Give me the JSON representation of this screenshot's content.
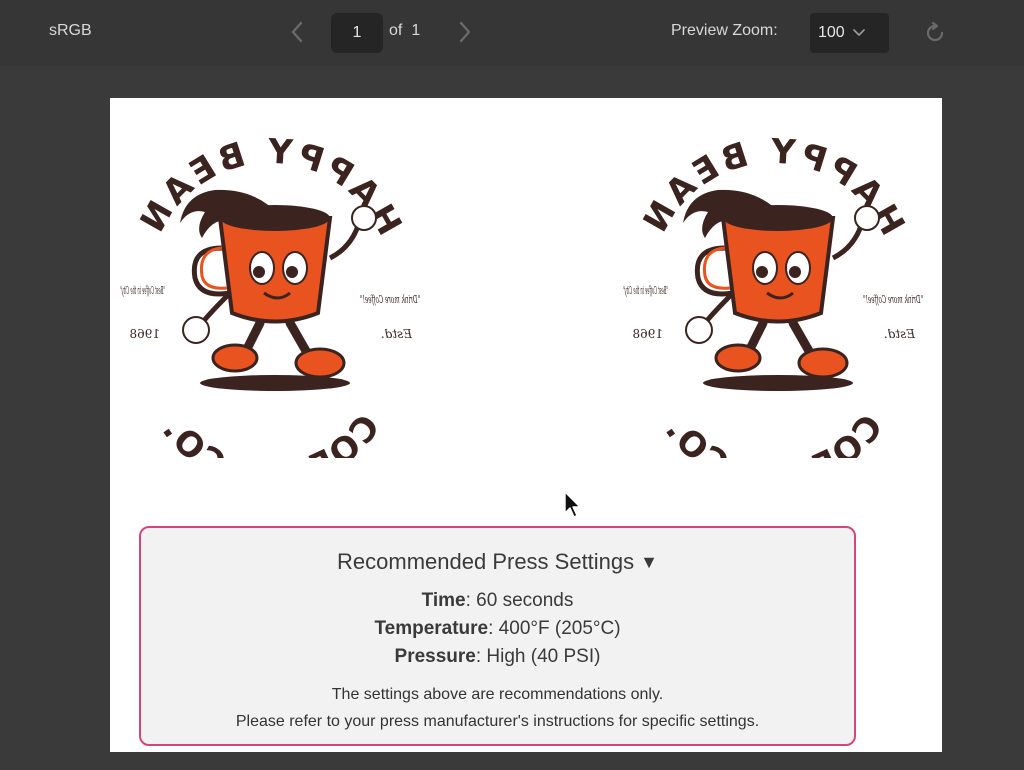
{
  "toolbar": {
    "color_space": "sRGB",
    "page_current": "1",
    "page_of_label": "of",
    "page_total": "1",
    "zoom_label": "Preview Zoom:",
    "zoom_value": "100",
    "icons": {
      "prev": "chevron-left-icon",
      "next": "chevron-right-icon",
      "zoom_dropdown": "chevron-down-icon",
      "reset": "reset-icon"
    }
  },
  "artwork": {
    "top_text": "HAPPY BEAN",
    "bottom_text": "COFFEE CO.",
    "left_script": "\"Best Coffee in the City\"",
    "right_script": "\"Drink more Coffee!\"",
    "year": "1968",
    "est": "Estd.",
    "mirrored": true,
    "colors": {
      "ink": "#3b2420",
      "cup": "#e8531f"
    }
  },
  "settings": {
    "title": "Recommended Press Settings",
    "caret": "▼",
    "time_label": "Time",
    "time_value": ": 60 seconds",
    "temp_label": "Temperature",
    "temp_value": ": 400°F (205°C)",
    "pressure_label": "Pressure",
    "pressure_value": ": High (40 PSI)",
    "note1": "The settings above are recommendations only.",
    "note2": "Please refer to your press manufacturer's instructions for specific settings.",
    "border_color": "#d4457e"
  }
}
